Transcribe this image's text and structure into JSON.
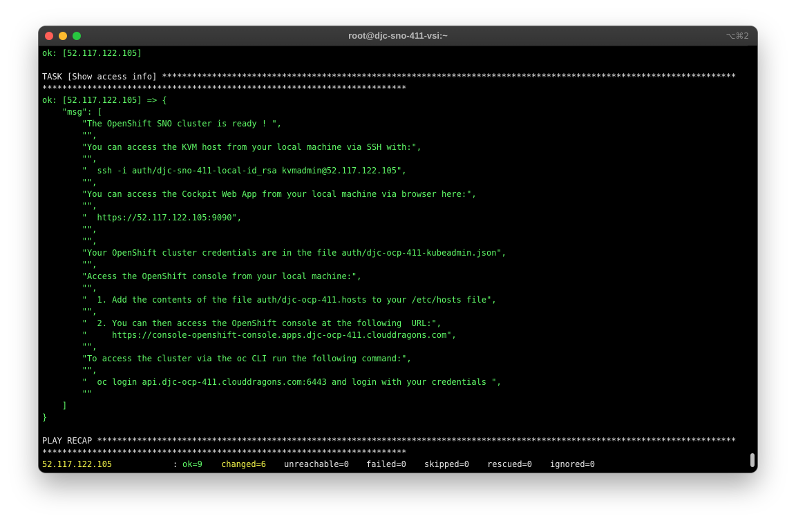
{
  "window": {
    "title": "root@djc-sno-411-vsi:~",
    "shortcut": "⌥⌘2"
  },
  "lines": [
    {
      "text": "ok: [52.117.122.105]",
      "color": "green"
    },
    {
      "text": "",
      "color": "white"
    },
    {
      "text": "TASK [Show access info] *******************************************************************************************************************",
      "color": "white"
    },
    {
      "text": "*************************************************************************",
      "color": "white"
    },
    {
      "text": "ok: [52.117.122.105] => {",
      "color": "green"
    },
    {
      "text": "    \"msg\": [",
      "color": "green"
    },
    {
      "text": "        \"The OpenShift SNO cluster is ready ! \",",
      "color": "green"
    },
    {
      "text": "        \"\",",
      "color": "green"
    },
    {
      "text": "        \"You can access the KVM host from your local machine via SSH with:\",",
      "color": "green"
    },
    {
      "text": "        \"\",",
      "color": "green"
    },
    {
      "text": "        \"  ssh -i auth/djc-sno-411-local-id_rsa kvmadmin@52.117.122.105\",",
      "color": "green"
    },
    {
      "text": "        \"\",",
      "color": "green"
    },
    {
      "text": "        \"You can access the Cockpit Web App from your local machine via browser here:\",",
      "color": "green"
    },
    {
      "text": "        \"\",",
      "color": "green"
    },
    {
      "text": "        \"  https://52.117.122.105:9090\",",
      "color": "green"
    },
    {
      "text": "        \"\",",
      "color": "green"
    },
    {
      "text": "        \"\",",
      "color": "green"
    },
    {
      "text": "        \"Your OpenShift cluster credentials are in the file auth/djc-ocp-411-kubeadmin.json\",",
      "color": "green"
    },
    {
      "text": "        \"\",",
      "color": "green"
    },
    {
      "text": "        \"Access the OpenShift console from your local machine:\",",
      "color": "green"
    },
    {
      "text": "        \"\",",
      "color": "green"
    },
    {
      "text": "        \"  1. Add the contents of the file auth/djc-ocp-411.hosts to your /etc/hosts file\",",
      "color": "green"
    },
    {
      "text": "        \"\",",
      "color": "green"
    },
    {
      "text": "        \"  2. You can then access the OpenShift console at the following  URL:\",",
      "color": "green"
    },
    {
      "text": "        \"     https://console-openshift-console.apps.djc-ocp-411.clouddragons.com\",",
      "color": "green"
    },
    {
      "text": "        \"\",",
      "color": "green"
    },
    {
      "text": "        \"To access the cluster via the oc CLI run the following command:\",",
      "color": "green"
    },
    {
      "text": "        \"\",",
      "color": "green"
    },
    {
      "text": "        \"  oc login api.djc-ocp-411.clouddragons.com:6443 and login with your credentials \",",
      "color": "green"
    },
    {
      "text": "        \"\"",
      "color": "green"
    },
    {
      "text": "    ]",
      "color": "green"
    },
    {
      "text": "}",
      "color": "green"
    },
    {
      "text": "",
      "color": "white"
    },
    {
      "text": "PLAY RECAP ********************************************************************************************************************************",
      "color": "white"
    },
    {
      "text": "*************************************************************************",
      "color": "white"
    }
  ],
  "recap": {
    "host": "52.117.122.105",
    "colon": ": ",
    "ok": "ok=9",
    "changed": "changed=6",
    "unreachable": "unreachable=0",
    "failed": "failed=0",
    "skipped": "skipped=0",
    "rescued": "rescued=0",
    "ignored": "ignored=0"
  },
  "colors": {
    "green": "#5ff967",
    "white": "#e8e8e8",
    "yellow": "#f4f64a",
    "background": "#000000"
  }
}
